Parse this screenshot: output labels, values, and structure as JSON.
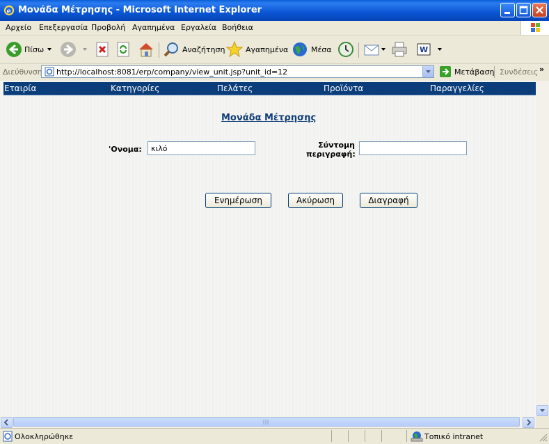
{
  "window": {
    "title": "Μονάδα Μέτρησης - Microsoft Internet Explorer"
  },
  "menu": [
    "Αρχείο",
    "Επεξεργασία",
    "Προβολή",
    "Αγαπημένα",
    "Εργαλεία",
    "Βοήθεια"
  ],
  "toolbar": {
    "back_label": "Πίσω",
    "search_label": "Αναζήτηση",
    "favorites_label": "Αγαπημένα",
    "media_label": "Μέσα"
  },
  "address": {
    "label": "Διεύθυνση",
    "url": "http://localhost:8081/erp/company/view_unit.jsp?unit_id=12",
    "go_label": "Μετάβαση",
    "links_label": "Συνδέσεις"
  },
  "nav": [
    "Εταιρία",
    "Κατηγορίες",
    "Πελάτες",
    "Προϊόντα",
    "Παραγγελίες"
  ],
  "page": {
    "heading": "Μονάδα Μέτρησης",
    "name_label": "'Ονομα:",
    "name_value": "κιλό",
    "desc_label_line1": "Σύντομη",
    "desc_label_line2": "περιγραφή:",
    "desc_value": "",
    "update_button": "Ενημέρωση",
    "cancel_button": "Ακύρωση",
    "delete_button": "Διαγραφή"
  },
  "status": {
    "text": "Ολοκληρώθηκε",
    "zone": "Τοπικό intranet"
  },
  "colors": {
    "title_bar": "#0a55d4",
    "nav_bar": "#0a3d7a",
    "heading": "#123e78"
  }
}
